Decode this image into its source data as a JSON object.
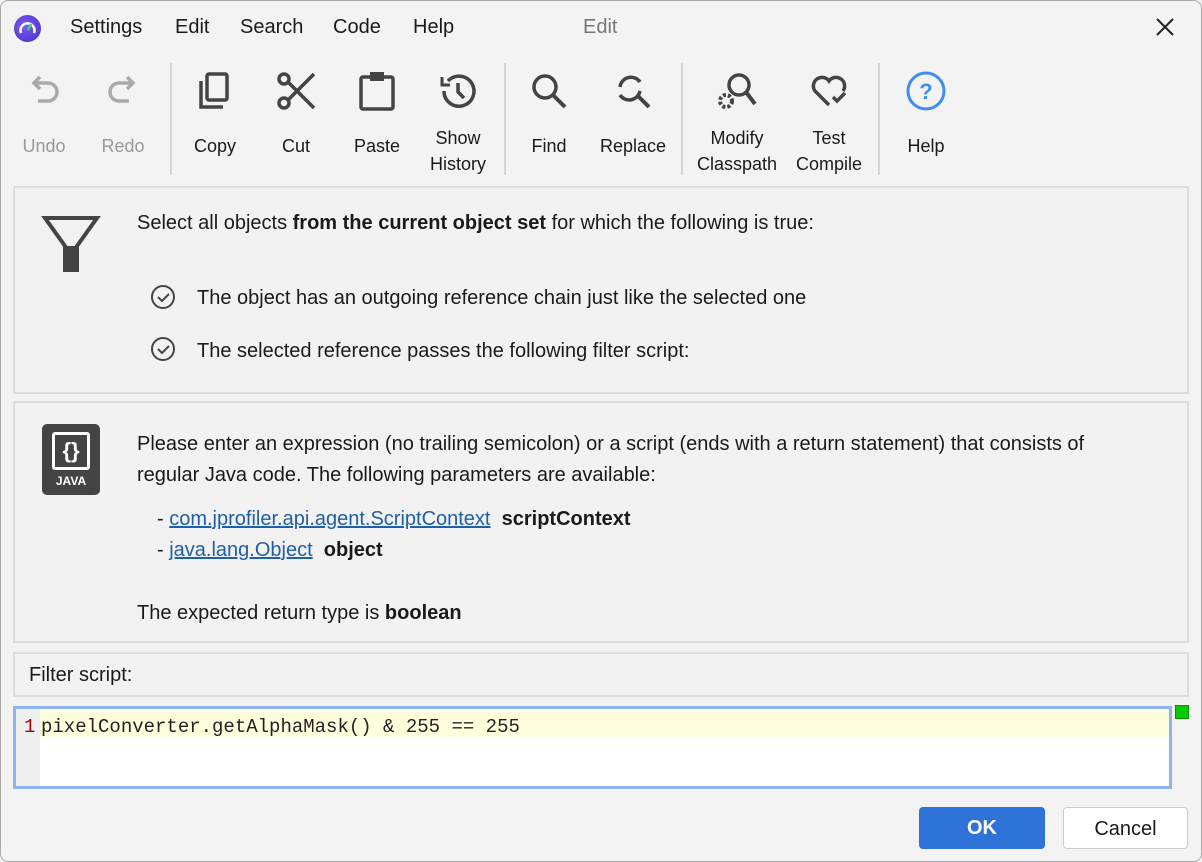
{
  "menu": {
    "items": [
      "Settings",
      "Edit",
      "Search",
      "Code",
      "Help"
    ],
    "title": "Edit"
  },
  "toolbar": {
    "undo": "Undo",
    "redo": "Redo",
    "copy": "Copy",
    "cut": "Cut",
    "paste": "Paste",
    "show_history": [
      "Show",
      "History"
    ],
    "find": "Find",
    "replace": "Replace",
    "modify_classpath": [
      "Modify",
      "Classpath"
    ],
    "test_compile": [
      "Test",
      "Compile"
    ],
    "help": "Help"
  },
  "filter": {
    "intro_pre": "Select all objects ",
    "intro_bold": "from the current object set",
    "intro_post": " for which the following is true:",
    "conditions": [
      "The object has an outgoing reference chain just like the selected one",
      "The selected reference passes the following filter script:"
    ]
  },
  "info": {
    "line1": "Please enter an expression (no trailing semicolon) or a script (ends with a return statement) that consists of",
    "line2": "regular Java code. The following parameters are available:",
    "params": [
      {
        "type": "com.jprofiler.api.agent.ScriptContext",
        "name": "scriptContext"
      },
      {
        "type": "java.lang.Object",
        "name": "object"
      }
    ],
    "return_pre": "The expected return type is ",
    "return_type": "boolean",
    "java_label": "JAVA"
  },
  "script": {
    "label": "Filter script:",
    "line_number": "1",
    "code": "pixelConverter.getAlphaMask() & 255 == 255"
  },
  "buttons": {
    "ok": "OK",
    "cancel": "Cancel"
  },
  "colors": {
    "accent": "#2f73d9",
    "status_ok": "#00cc00"
  }
}
